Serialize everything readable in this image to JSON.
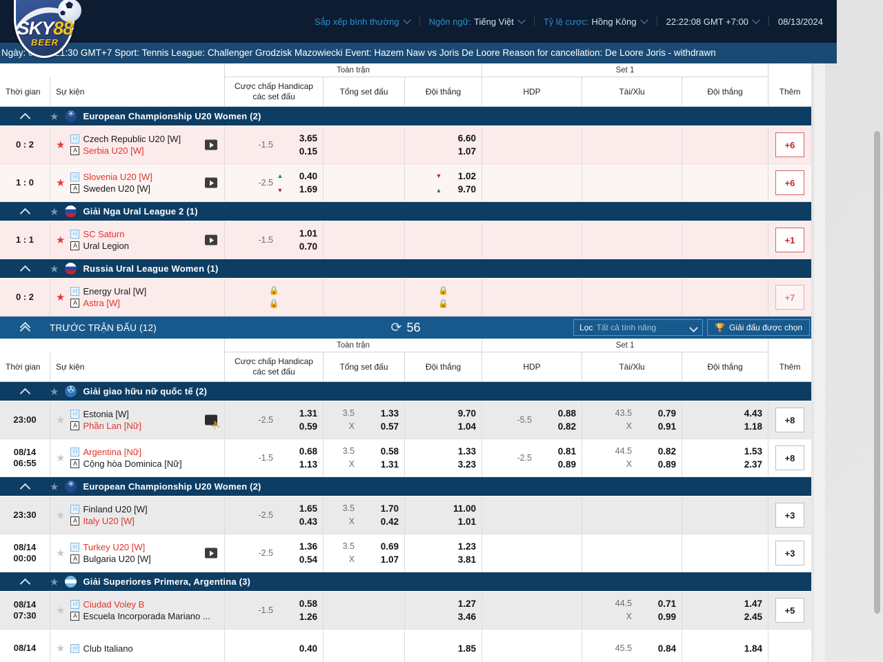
{
  "brand": {
    "name_main": "SKY",
    "name_num": "88",
    "name_sub": "BEER"
  },
  "topbar": {
    "sort_label": "Sắp xếp bình thường",
    "language_label": "Ngôn ngữ:",
    "language_value": "Tiếng Việt",
    "odds_label": "Tỷ lệ cược:",
    "odds_value": "Hồng Kông",
    "clock": "22:22:08 GMT +7:00",
    "date": "08/13/2024"
  },
  "marquee": {
    "text": "Ngày: 08-13 21:30 GMT+7 Sport: Tennis League: Challenger Grodzisk Mazowiecki Event: Hazem Naw vs Joris De Loore Reason for cancellation: De Loore Joris - withdrawn"
  },
  "columns": {
    "time": "Thời gian",
    "event": "Sự kiện",
    "group_full": "Toàn trận",
    "group_set1": "Set 1",
    "handicap": "Cược chấp Handicap các set đấu",
    "handicap_l1": "Cược chấp Handicap",
    "handicap_l2": "các set đấu",
    "total": "Tổng set đấu",
    "moneyline": "Đội thắng",
    "set_hdp": "HDP",
    "set_total": "Tài/Xỉu",
    "set_ml": "Đội thắng",
    "more": "Thêm"
  },
  "prematch_bar": {
    "title": "TRƯỚC TRẬN ĐẤU (12)",
    "refresh_icon": "refresh-icon",
    "refresh_count": "56",
    "filter_label": "Lọc",
    "filter_value": "Tất cả tính năng",
    "tournament_button": "Giải đấu được chọn",
    "trophy_icon": "trophy-icon"
  },
  "live_sections": [
    {
      "league": "European Championship U20 Women (2)",
      "flag": "flag-europe",
      "matches": [
        {
          "time": "0 : 2",
          "home": "Czech Republic U20 [W]",
          "away": "Serbia U20 [W]",
          "home_hot": false,
          "away_hot": true,
          "media": "play-icon",
          "starred": true,
          "handicap": {
            "line": "-1.5",
            "line2": "",
            "p1": "3.65",
            "p2": "0.15",
            "a1": "",
            "a2": ""
          },
          "total": {
            "line": "",
            "line2": "",
            "p1": "",
            "p2": "",
            "a1": "",
            "a2": ""
          },
          "moneyline": {
            "line": "",
            "line2": "",
            "p1": "6.60",
            "p2": "1.07",
            "a1": "",
            "a2": ""
          },
          "set_hdp": {
            "line": "",
            "line2": "",
            "p1": "",
            "p2": "",
            "a1": "",
            "a2": ""
          },
          "set_total": {
            "line": "",
            "line2": "",
            "p1": "",
            "p2": "",
            "a1": "",
            "a2": ""
          },
          "set_ml": {
            "line": "",
            "line2": "",
            "p1": "",
            "p2": "",
            "a1": "",
            "a2": ""
          },
          "more": "+6",
          "more_dim": false
        },
        {
          "time": "1 : 0",
          "home": "Slovenia U20 [W]",
          "away": "Sweden U20 [W]",
          "home_hot": true,
          "away_hot": false,
          "media": "play-icon",
          "starred": true,
          "handicap": {
            "line": "-2.5",
            "line2": "",
            "p1": "0.40",
            "p2": "1.69",
            "a1": "up",
            "a2": "down"
          },
          "total": {
            "line": "",
            "line2": "",
            "p1": "",
            "p2": "",
            "a1": "",
            "a2": ""
          },
          "moneyline": {
            "line": "",
            "line2": "",
            "p1": "1.02",
            "p2": "9.70",
            "a1": "down",
            "a2": "up"
          },
          "set_hdp": {
            "line": "",
            "line2": "",
            "p1": "",
            "p2": "",
            "a1": "",
            "a2": ""
          },
          "set_total": {
            "line": "",
            "line2": "",
            "p1": "",
            "p2": "",
            "a1": "",
            "a2": ""
          },
          "set_ml": {
            "line": "",
            "line2": "",
            "p1": "",
            "p2": "",
            "a1": "",
            "a2": ""
          },
          "more": "+6",
          "more_dim": false
        }
      ]
    },
    {
      "league": "Giải Nga Ural League 2 (1)",
      "flag": "flag-russia",
      "matches": [
        {
          "time": "1 : 1",
          "home": "SC Saturn",
          "away": "Ural Legion",
          "home_hot": true,
          "away_hot": false,
          "media": "play-icon",
          "starred": true,
          "handicap": {
            "line": "-1.5",
            "line2": "",
            "p1": "1.01",
            "p2": "0.70",
            "a1": "",
            "a2": ""
          },
          "total": {
            "line": "",
            "line2": "",
            "p1": "",
            "p2": "",
            "a1": "",
            "a2": ""
          },
          "moneyline": {
            "line": "",
            "line2": "",
            "p1": "",
            "p2": "",
            "a1": "",
            "a2": ""
          },
          "set_hdp": {
            "line": "",
            "line2": "",
            "p1": "",
            "p2": "",
            "a1": "",
            "a2": ""
          },
          "set_total": {
            "line": "",
            "line2": "",
            "p1": "",
            "p2": "",
            "a1": "",
            "a2": ""
          },
          "set_ml": {
            "line": "",
            "line2": "",
            "p1": "",
            "p2": "",
            "a1": "",
            "a2": ""
          },
          "more": "+1",
          "more_dim": false
        }
      ]
    },
    {
      "league": "Russia Ural League Women (1)",
      "flag": "flag-russia",
      "matches": [
        {
          "time": "0 : 2",
          "home": "Energy Ural [W]",
          "away": "Astra [W]",
          "home_hot": false,
          "away_hot": true,
          "media": "",
          "starred": true,
          "handicap": {
            "locked": true
          },
          "total": {
            "line": "",
            "line2": "",
            "p1": "",
            "p2": "",
            "a1": "",
            "a2": ""
          },
          "moneyline": {
            "locked": true
          },
          "set_hdp": {
            "line": "",
            "line2": "",
            "p1": "",
            "p2": "",
            "a1": "",
            "a2": ""
          },
          "set_total": {
            "line": "",
            "line2": "",
            "p1": "",
            "p2": "",
            "a1": "",
            "a2": ""
          },
          "set_ml": {
            "line": "",
            "line2": "",
            "p1": "",
            "p2": "",
            "a1": "",
            "a2": ""
          },
          "more": "+7",
          "more_dim": true
        }
      ]
    }
  ],
  "prematch_sections": [
    {
      "league": "Giải giao hữu nữ quốc tế (2)",
      "flag": "flag-globe",
      "matches": [
        {
          "time": "23:00",
          "time2": "",
          "home": "Estonia [W]",
          "away": "Phần Lan [Nữ]",
          "home_hot": false,
          "away_hot": true,
          "media": "stats-icon",
          "starred": false,
          "handicap": {
            "line": "-2.5",
            "p1": "1.31",
            "p2": "0.59"
          },
          "total": {
            "line": "3.5",
            "line2": "X",
            "p1": "1.33",
            "p2": "0.57"
          },
          "moneyline": {
            "p1": "9.70",
            "p2": "1.04"
          },
          "set_hdp": {
            "line": "-5.5",
            "p1": "0.88",
            "p2": "0.82"
          },
          "set_total": {
            "line": "43.5",
            "line2": "X",
            "p1": "0.79",
            "p2": "0.91"
          },
          "set_ml": {
            "p1": "4.43",
            "p2": "1.18"
          },
          "more": "+8"
        },
        {
          "time": "08/14",
          "time2": "06:55",
          "home": "Argentina [Nữ]",
          "away": "Cộng hòa Dominica [Nữ]",
          "home_hot": true,
          "away_hot": false,
          "media": "",
          "starred": false,
          "handicap": {
            "line": "-1.5",
            "p1": "0.68",
            "p2": "1.13"
          },
          "total": {
            "line": "3.5",
            "line2": "X",
            "p1": "0.58",
            "p2": "1.31"
          },
          "moneyline": {
            "p1": "1.33",
            "p2": "3.23"
          },
          "set_hdp": {
            "line": "-2.5",
            "p1": "0.81",
            "p2": "0.89"
          },
          "set_total": {
            "line": "44.5",
            "line2": "X",
            "p1": "0.82",
            "p2": "0.89"
          },
          "set_ml": {
            "p1": "1.53",
            "p2": "2.37"
          },
          "more": "+8"
        }
      ]
    },
    {
      "league": "European Championship U20 Women (2)",
      "flag": "flag-europe",
      "matches": [
        {
          "time": "23:30",
          "time2": "",
          "home": "Finland U20 [W]",
          "away": "Italy U20 [W]",
          "home_hot": false,
          "away_hot": true,
          "media": "",
          "starred": false,
          "handicap": {
            "line": "-2.5",
            "p1": "1.65",
            "p2": "0.43"
          },
          "total": {
            "line": "3.5",
            "line2": "X",
            "p1": "1.70",
            "p2": "0.42"
          },
          "moneyline": {
            "p1": "11.00",
            "p2": "1.01"
          },
          "set_hdp": {
            "line": "",
            "p1": "",
            "p2": ""
          },
          "set_total": {
            "line": "",
            "line2": "",
            "p1": "",
            "p2": ""
          },
          "set_ml": {
            "p1": "",
            "p2": ""
          },
          "more": "+3"
        },
        {
          "time": "08/14",
          "time2": "00:00",
          "home": "Turkey U20 [W]",
          "away": "Bulgaria U20 [W]",
          "home_hot": true,
          "away_hot": false,
          "media": "play-icon",
          "starred": false,
          "handicap": {
            "line": "-2.5",
            "p1": "1.36",
            "p2": "0.54"
          },
          "total": {
            "line": "3.5",
            "line2": "X",
            "p1": "0.69",
            "p2": "1.07"
          },
          "moneyline": {
            "p1": "1.23",
            "p2": "3.81"
          },
          "set_hdp": {
            "line": "",
            "p1": "",
            "p2": ""
          },
          "set_total": {
            "line": "",
            "line2": "",
            "p1": "",
            "p2": ""
          },
          "set_ml": {
            "p1": "",
            "p2": ""
          },
          "more": "+3"
        }
      ]
    },
    {
      "league": "Giải Superiores Primera, Argentina (3)",
      "flag": "flag-argentina",
      "matches": [
        {
          "time": "08/14",
          "time2": "07:30",
          "home": "Ciudad Voley B",
          "away": "Escuela Incorporada Mariano ...",
          "home_hot": true,
          "away_hot": false,
          "media": "",
          "starred": false,
          "handicap": {
            "line": "-1.5",
            "p1": "0.58",
            "p2": "1.26"
          },
          "total": {
            "line": "",
            "line2": "",
            "p1": "",
            "p2": ""
          },
          "moneyline": {
            "p1": "1.27",
            "p2": "3.46"
          },
          "set_hdp": {
            "line": "",
            "p1": "",
            "p2": ""
          },
          "set_total": {
            "line": "44.5",
            "line2": "X",
            "p1": "0.71",
            "p2": "0.99"
          },
          "set_ml": {
            "p1": "1.47",
            "p2": "2.45"
          },
          "more": "+5"
        },
        {
          "time": "08/14",
          "time2": "",
          "home": "Club Italiano",
          "away": "",
          "home_hot": false,
          "away_hot": false,
          "media": "",
          "starred": false,
          "handicap": {
            "line": "",
            "p1": "0.40",
            "p2": ""
          },
          "total": {
            "line": "",
            "line2": "",
            "p1": "",
            "p2": ""
          },
          "moneyline": {
            "p1": "1.85",
            "p2": ""
          },
          "set_hdp": {
            "line": "",
            "p1": "",
            "p2": ""
          },
          "set_total": {
            "line": "45.5",
            "line2": "",
            "p1": "0.84",
            "p2": ""
          },
          "set_ml": {
            "p1": "1.84",
            "p2": ""
          },
          "more": ""
        }
      ]
    }
  ]
}
